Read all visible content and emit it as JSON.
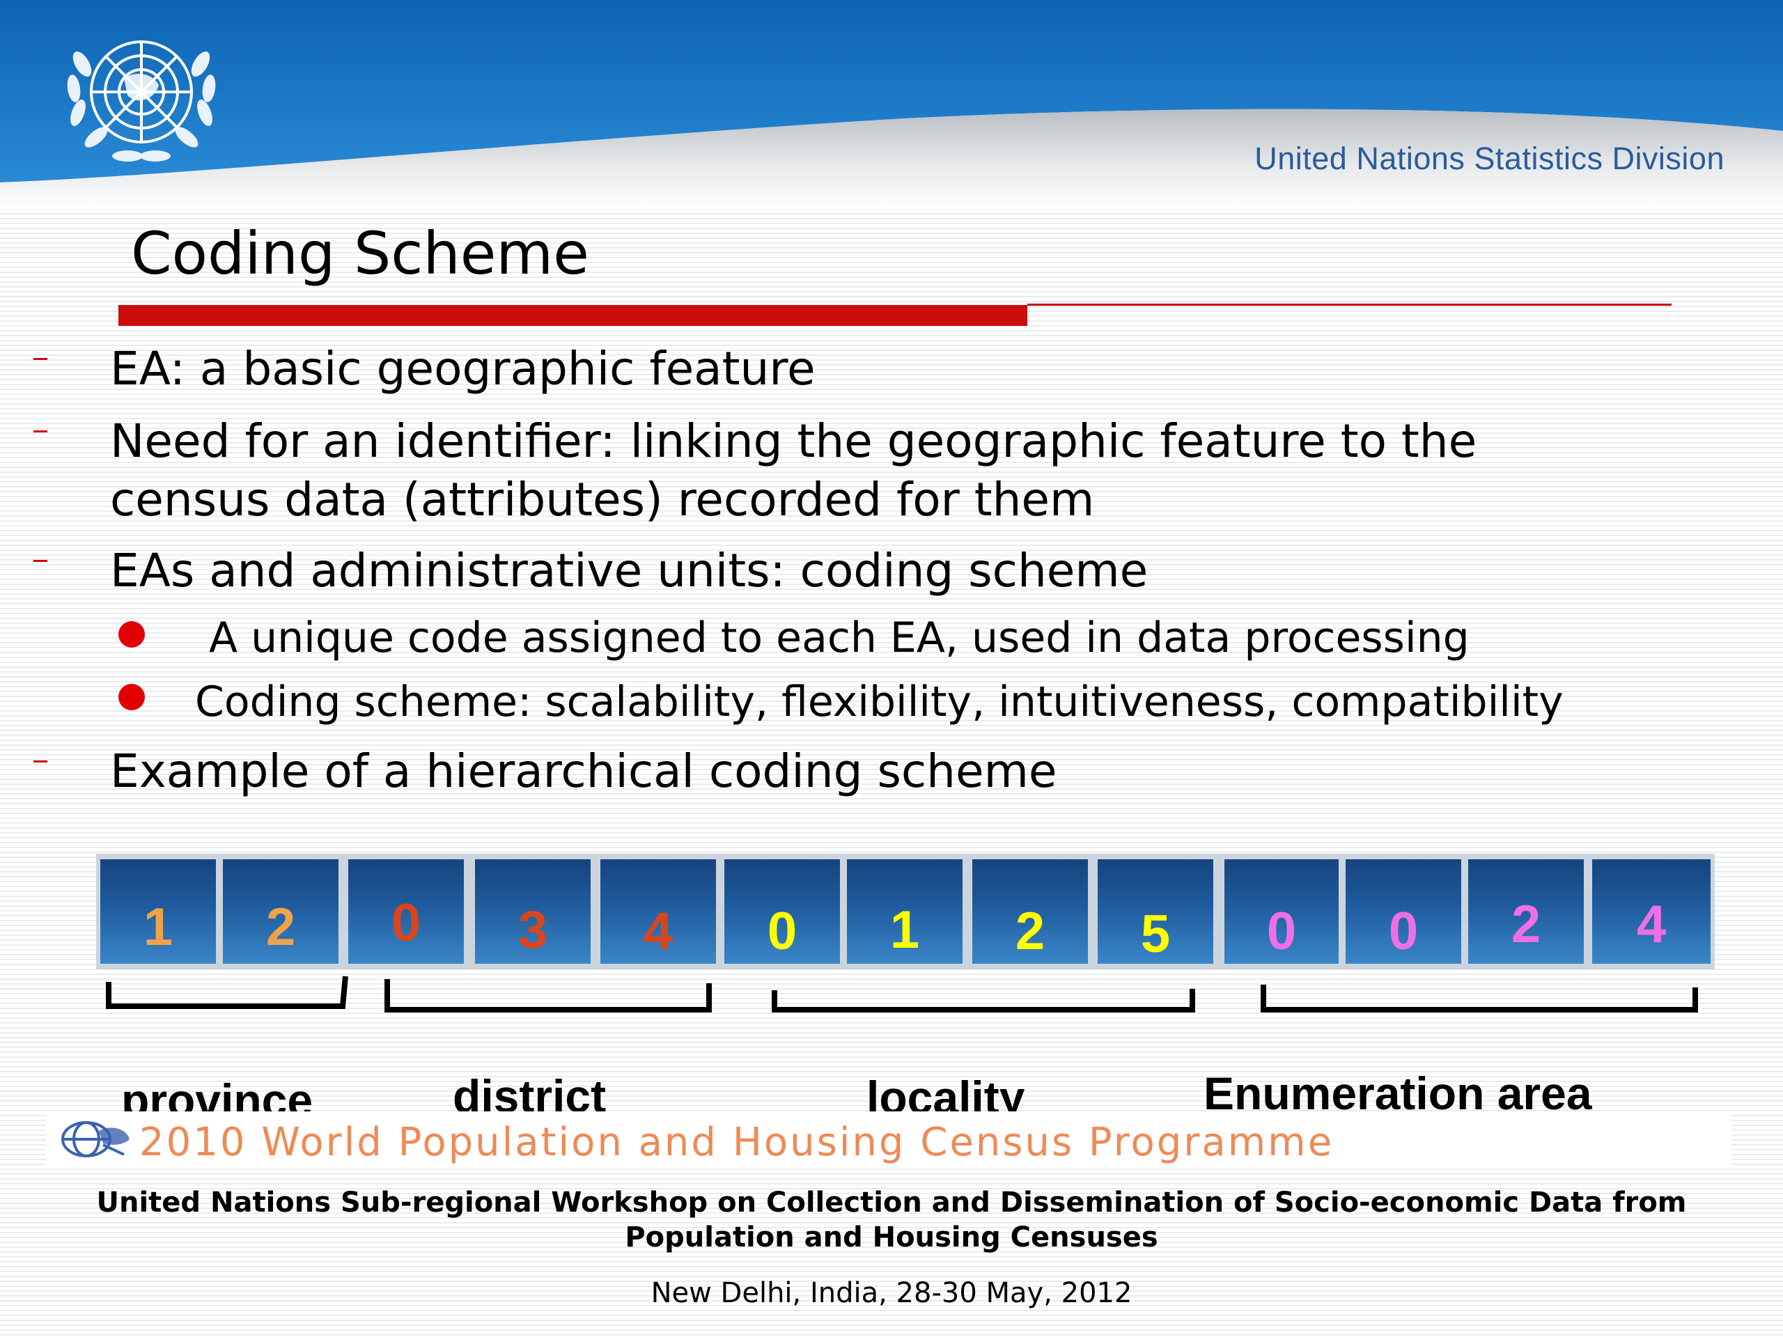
{
  "header": {
    "organization": "United Nations Statistics Division",
    "logo_icon": "un-emblem-icon"
  },
  "slide": {
    "title": "Coding Scheme",
    "bullets": [
      "EA: a basic geographic feature",
      "Need for an identifier: linking the geographic feature to the",
      "census data (attributes) recorded for them",
      "EAs and administrative units: coding scheme",
      "Example of a hierarchical coding scheme"
    ],
    "sub_bullets": [
      "A unique code assigned to each EA, used in data processing",
      "Coding scheme: scalability, flexibility, intuitiveness, compatibility"
    ]
  },
  "code_example": {
    "digits": [
      "1",
      "2",
      "0",
      "3",
      "4",
      "0",
      "1",
      "2",
      "5",
      "0",
      "0",
      "2",
      "4"
    ],
    "levels": [
      {
        "label": "province",
        "color": "#f0a24a"
      },
      {
        "label": "district",
        "color": "#d9461c"
      },
      {
        "label": "locality",
        "color": "#ffff00"
      },
      {
        "label": "Enumeration area",
        "color": "#ee6fe6"
      }
    ]
  },
  "footer": {
    "programme": "2010 World Population and Housing Census Programme",
    "workshop_line1": "United Nations Sub-regional Workshop on Collection and Dissemination of Socio-economic Data from",
    "workshop_line2": "Population and Housing Censuses",
    "location_date": "New Delhi, India, 28-30 May, 2012"
  },
  "colors": {
    "accent_red": "#cc0c0c",
    "header_blue": "#1672c2",
    "org_text": "#2a5b9c"
  }
}
